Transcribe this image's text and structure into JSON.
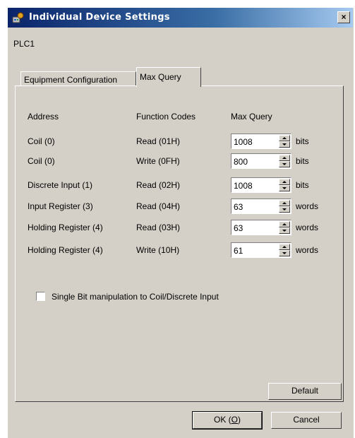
{
  "window": {
    "title": "Individual Device Settings",
    "close_label": "×",
    "device_name": "PLC1"
  },
  "tabs": [
    {
      "label": "Equipment Configuration",
      "active": false
    },
    {
      "label": "Max Query",
      "active": true
    }
  ],
  "table": {
    "headers": [
      "Address",
      "Function Codes",
      "Max Query"
    ],
    "rows": [
      {
        "address": "Coil (0)",
        "function": "Read (01H)",
        "value": "1008",
        "unit": "bits"
      },
      {
        "address": "Coil (0)",
        "function": "Write (0FH)",
        "value": "800",
        "unit": "bits"
      },
      {
        "address": "Discrete Input (1)",
        "function": "Read (02H)",
        "value": "1008",
        "unit": "bits"
      },
      {
        "address": "Input Register (3)",
        "function": "Read (04H)",
        "value": "63",
        "unit": "words"
      },
      {
        "address": "Holding Register (4)",
        "function": "Read (03H)",
        "value": "63",
        "unit": "words"
      },
      {
        "address": "Holding Register (4)",
        "function": "Write (10H)",
        "value": "61",
        "unit": "words"
      }
    ]
  },
  "option": {
    "label": "Single Bit manipulation to Coil/Discrete Input",
    "checked": false
  },
  "buttons": {
    "default": "Default",
    "ok": "OK (O)",
    "ok_prefix": "OK (",
    "ok_key": "O",
    "ok_suffix": ")",
    "cancel": "Cancel"
  }
}
